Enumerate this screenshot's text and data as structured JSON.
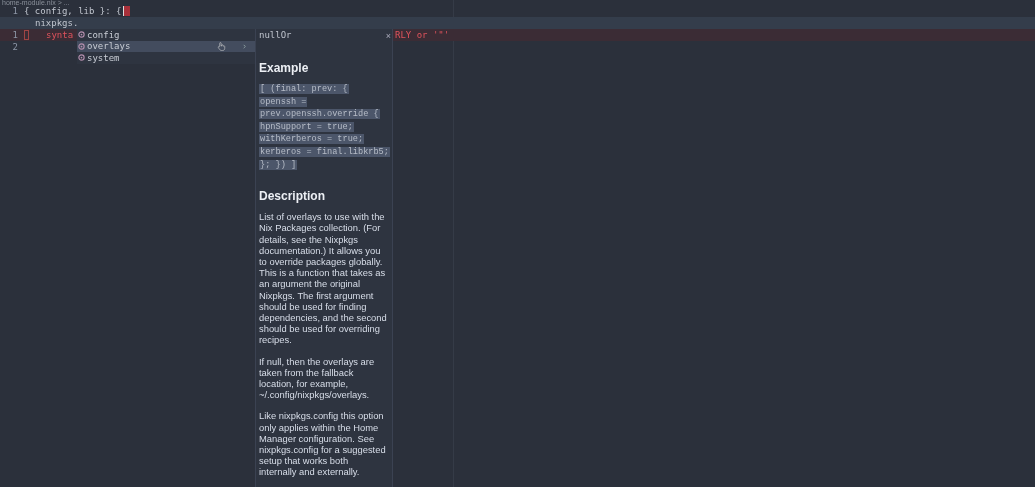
{
  "breadcrumb": "home-module.nix > ...",
  "lines": [
    {
      "number": "1",
      "text": "{ config, lib }: {",
      "current": false
    },
    {
      "text": "nixpkgs.",
      "current": true
    },
    {
      "number": "1",
      "text": "synta",
      "current": false,
      "error": true
    },
    {
      "number": "2",
      "current": false
    }
  ],
  "error_message": "RLY or '\"'",
  "completion": {
    "items": [
      {
        "label": "config",
        "selected": false
      },
      {
        "label": "overlays",
        "selected": true
      },
      {
        "label": "system",
        "selected": false
      }
    ]
  },
  "doc": {
    "title": "nullOr",
    "close": "×",
    "example_heading": "Example",
    "example_code": [
      "[ (final: prev: {",
      "openssh =",
      "prev.openssh.override {",
      "hpnSupport = true;",
      "withKerberos = true;",
      "kerberos = final.libkrb5;",
      "}; }) ]"
    ],
    "description_heading": "Description",
    "paragraphs": [
      "List of overlays to use with the Nix Packages collection. (For details, see the Nixpkgs documentation.) It allows you to override packages globally. This is a function that takes as an argument the original Nixpkgs. The first argument should be used for finding dependencies, and the second should be used for overriding recipes.",
      "If null, then the overlays are taken from the fallback location, for example, ~/.config/nixpkgs/overlays.",
      "Like nixpkgs.config this option only applies within the Home Manager configuration. See nixpkgs.config for a suggested setup that works both internally and externally."
    ]
  }
}
